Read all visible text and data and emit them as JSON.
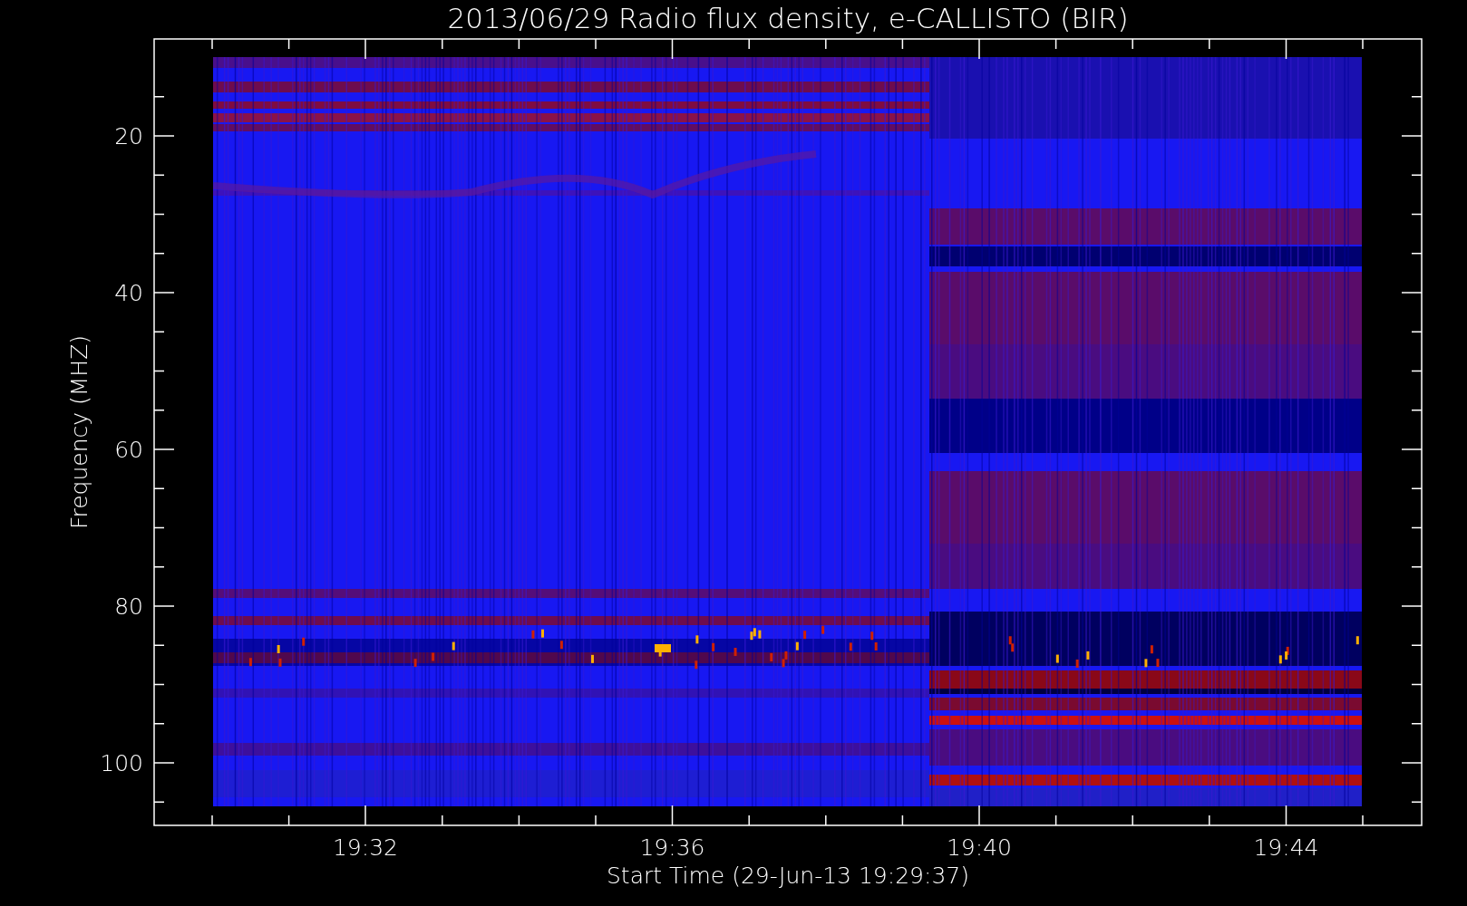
{
  "title": "2013/06/29  Radio flux density, e-CALLISTO (BIR)",
  "y_axis": {
    "label": "Frequency (MHZ)",
    "ticks": [
      "20",
      "40",
      "60",
      "80",
      "100"
    ]
  },
  "x_axis": {
    "label": "Start Time (29-Jun-13 19:29:37)",
    "ticks": [
      "19:32",
      "19:36",
      "19:40",
      "19:44"
    ]
  }
}
